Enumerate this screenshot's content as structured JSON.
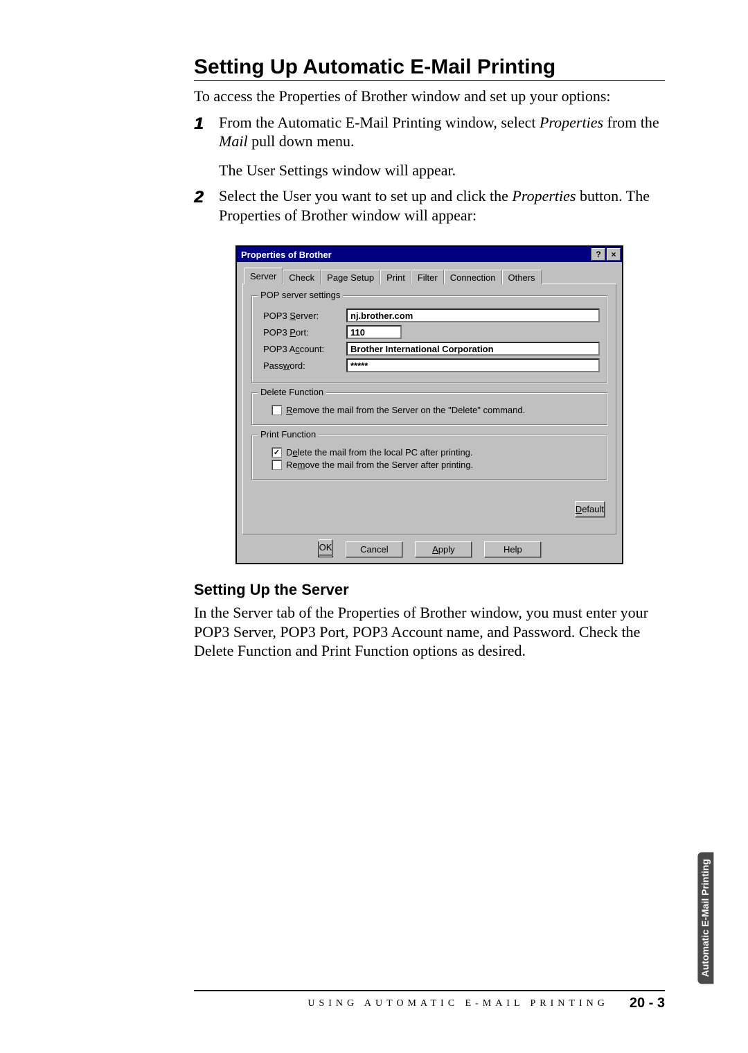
{
  "heading": "Setting Up Automatic E-Mail Printing",
  "intro": "To access the Properties of Brother window and set up your options:",
  "steps": {
    "s1a": "From the Automatic E-Mail Printing window, select ",
    "s1b": "Properties",
    "s1c": " from the ",
    "s1d": "Mail",
    "s1e": " pull down menu.",
    "s1f": "The User Settings window will appear.",
    "s2a": "Select the User you want to set up and click the ",
    "s2b": "Properties",
    "s2c": " button. The Properties of Brother window will appear:"
  },
  "dialog": {
    "title": "Properties of Brother",
    "help": "?",
    "close": "×",
    "tabs": [
      "Server",
      "Check",
      "Page Setup",
      "Print",
      "Filter",
      "Connection",
      "Others"
    ],
    "group_pop": "POP server settings",
    "labels": {
      "server_pre": "POP3 ",
      "server_u": "S",
      "server_post": "erver:",
      "port_pre": "POP3 ",
      "port_u": "P",
      "port_post": "ort:",
      "acct_pre": "POP3 A",
      "acct_u": "c",
      "acct_post": "count:",
      "pw_pre": "Pass",
      "pw_u": "w",
      "pw_post": "ord:"
    },
    "values": {
      "server": "nj.brother.com",
      "port": "110",
      "account": "Brother International Corporation",
      "password": "*****"
    },
    "group_delete": "Delete Function",
    "delete_chk_u": "R",
    "delete_chk_post": "emove the mail from the Server on the \"Delete\" command.",
    "group_print": "Print Function",
    "print_chk1_pre": "D",
    "print_chk1_u": "e",
    "print_chk1_post": "lete the mail from the local PC after printing.",
    "print_chk2_pre": "Re",
    "print_chk2_u": "m",
    "print_chk2_post": "ove the mail from the Server after printing.",
    "default_u": "D",
    "default_post": "efault",
    "buttons": {
      "ok": "OK",
      "cancel": "Cancel",
      "apply_u": "A",
      "apply_post": "pply",
      "help": "Help"
    }
  },
  "subheading": "Setting Up the Server",
  "subbody": "In the Server tab of the Properties of Brother window, you must enter your POP3 Server, POP3 Port, POP3 Account name, and Password. Check the Delete  Function and Print Function options as desired.",
  "footer": {
    "text": "USING AUTOMATIC E-MAIL PRINTING",
    "pagenum": "20 - 3"
  },
  "sidetab": "Automatic\nE-Mail Printing"
}
